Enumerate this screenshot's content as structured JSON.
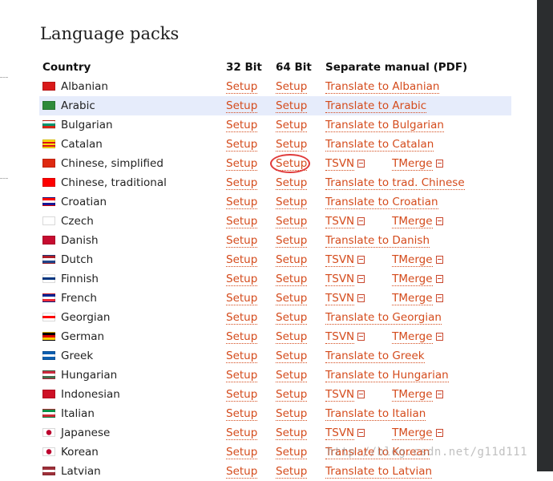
{
  "page": {
    "heading": "Language packs"
  },
  "table": {
    "headers": {
      "country": "Country",
      "bit32": "32 Bit",
      "bit64": "64 Bit",
      "manual": "Separate manual (PDF)"
    },
    "rows": [
      {
        "country": "Albanian",
        "bit32": "Setup",
        "bit64": "Setup",
        "manual": "Translate to Albanian",
        "flag": [
          "#d91a1a",
          "#d91a1a"
        ],
        "highlighted": false
      },
      {
        "country": "Arabic",
        "bit32": "Setup",
        "bit64": "Setup",
        "manual": "Translate to Arabic",
        "flag": [
          "#2e8b3a",
          "#2e8b3a"
        ],
        "highlighted": true
      },
      {
        "country": "Bulgarian",
        "bit32": "Setup",
        "bit64": "Setup",
        "manual": "Translate to Bulgarian",
        "flag": [
          "#ffffff",
          "#00966e",
          "#d62612"
        ],
        "highlighted": false
      },
      {
        "country": "Catalan",
        "bit32": "Setup",
        "bit64": "Setup",
        "manual": "Translate to Catalan",
        "flag": [
          "#fcdd09",
          "#da121a",
          "#fcdd09",
          "#da121a"
        ],
        "highlighted": false
      },
      {
        "country": "Chinese, simplified",
        "bit32": "Setup",
        "bit64": "Setup",
        "tsvn": "TSVN",
        "tmerge": "TMerge",
        "flag": [
          "#de2910",
          "#de2910"
        ],
        "highlighted": false
      },
      {
        "country": "Chinese, traditional",
        "bit32": "Setup",
        "bit64": "Setup",
        "manual": "Translate to trad. Chinese",
        "flag": [
          "#fe0000",
          "#fe0000"
        ],
        "highlighted": false
      },
      {
        "country": "Croatian",
        "bit32": "Setup",
        "bit64": "Setup",
        "manual": "Translate to Croatian",
        "flag": [
          "#ff0000",
          "#ffffff",
          "#171796"
        ],
        "highlighted": false
      },
      {
        "country": "Czech",
        "bit32": "Setup",
        "bit64": "Setup",
        "tsvn": "TSVN",
        "tmerge": "TMerge",
        "flag": [
          "#ffffff",
          "#d7141a"
        ],
        "highlighted": false
      },
      {
        "country": "Danish",
        "bit32": "Setup",
        "bit64": "Setup",
        "manual": "Translate to Danish",
        "flag": [
          "#c60c30",
          "#c60c30"
        ],
        "highlighted": false
      },
      {
        "country": "Dutch",
        "bit32": "Setup",
        "bit64": "Setup",
        "tsvn": "TSVN",
        "tmerge": "TMerge",
        "flag": [
          "#ae1c28",
          "#ffffff",
          "#21468b"
        ],
        "highlighted": false
      },
      {
        "country": "Finnish",
        "bit32": "Setup",
        "bit64": "Setup",
        "tsvn": "TSVN",
        "tmerge": "TMerge",
        "flag": [
          "#ffffff",
          "#003580",
          "#ffffff"
        ],
        "highlighted": false
      },
      {
        "country": "French",
        "bit32": "Setup",
        "bit64": "Setup",
        "tsvn": "TSVN",
        "tmerge": "TMerge",
        "flag": [
          "#002395",
          "#ffffff",
          "#ed2939"
        ],
        "highlighted": false
      },
      {
        "country": "Georgian",
        "bit32": "Setup",
        "bit64": "Setup",
        "manual": "Translate to Georgian",
        "flag": [
          "#ffffff",
          "#ff0000",
          "#ffffff"
        ],
        "highlighted": false
      },
      {
        "country": "German",
        "bit32": "Setup",
        "bit64": "Setup",
        "tsvn": "TSVN",
        "tmerge": "TMerge",
        "flag": [
          "#000000",
          "#dd0000",
          "#ffce00"
        ],
        "highlighted": false
      },
      {
        "country": "Greek",
        "bit32": "Setup",
        "bit64": "Setup",
        "manual": "Translate to Greek",
        "flag": [
          "#0d5eaf",
          "#ffffff",
          "#0d5eaf"
        ],
        "highlighted": false
      },
      {
        "country": "Hungarian",
        "bit32": "Setup",
        "bit64": "Setup",
        "manual": "Translate to Hungarian",
        "flag": [
          "#cd2a3e",
          "#ffffff",
          "#436f4d"
        ],
        "highlighted": false
      },
      {
        "country": "Indonesian",
        "bit32": "Setup",
        "bit64": "Setup",
        "tsvn": "TSVN",
        "tmerge": "TMerge",
        "flag": [
          "#ce1126",
          "#ffffff"
        ],
        "highlighted": false
      },
      {
        "country": "Italian",
        "bit32": "Setup",
        "bit64": "Setup",
        "manual": "Translate to Italian",
        "flag": [
          "#009246",
          "#ffffff",
          "#ce2b37"
        ],
        "highlighted": false
      },
      {
        "country": "Japanese",
        "bit32": "Setup",
        "bit64": "Setup",
        "tsvn": "TSVN",
        "tmerge": "TMerge",
        "flag": [
          "#ffffff",
          "#ffffff"
        ],
        "highlighted": false
      },
      {
        "country": "Korean",
        "bit32": "Setup",
        "bit64": "Setup",
        "manual": "Translate to Korean",
        "flag": [
          "#ffffff",
          "#ffffff"
        ],
        "highlighted": false
      },
      {
        "country": "Latvian",
        "bit32": "Setup",
        "bit64": "Setup",
        "manual": "Translate to Latvian",
        "flag": [
          "#9e3039",
          "#ffffff",
          "#9e3039"
        ],
        "highlighted": false
      }
    ]
  },
  "watermark": "http://blog.csdn.net/g11d111",
  "colors": {
    "link": "#d44b1c",
    "highlight": "#e6ecfb",
    "annotation": "#e03b3b",
    "sidebar": "#2b2d2f"
  },
  "icons": {
    "pdf": "pdf-icon"
  }
}
